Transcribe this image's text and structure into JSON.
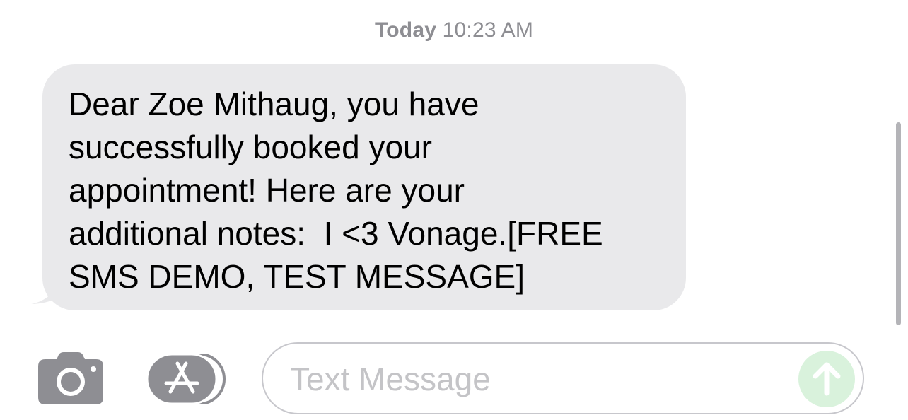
{
  "conversation": {
    "timestamp_day": "Today",
    "timestamp_time": "10:23 AM",
    "messages": [
      {
        "direction": "incoming",
        "text": "Dear Zoe Mithaug, you have\nsuccessfully booked your\nappointment! Here are your\nadditional notes:  I <3 Vonage.[FREE\nSMS DEMO, TEST MESSAGE]"
      }
    ]
  },
  "composer": {
    "placeholder": "Text Message",
    "value": "",
    "camera_icon": "camera-icon",
    "apps_icon": "app-store-icon",
    "send_icon": "arrow-up-icon"
  },
  "colors": {
    "incoming_bubble": "#e9e9eb",
    "timestamp": "#8e8e93",
    "icon_gray": "#8e8e93",
    "send_disabled": "#d9f2dc"
  }
}
